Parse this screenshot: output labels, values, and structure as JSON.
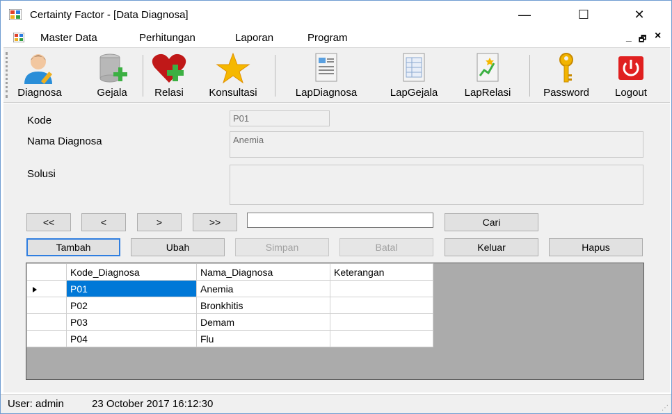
{
  "window": {
    "title": "Certainty Factor - [Data Diagnosa]",
    "controls": {
      "minimize": "—",
      "maximize": "☐",
      "close": "✕"
    }
  },
  "menu": {
    "items": [
      "Master Data",
      "Perhitungan",
      "Laporan",
      "Program"
    ],
    "mdi": {
      "minimize": "_",
      "restore": "🗗",
      "close": "×"
    }
  },
  "toolbar": {
    "items": [
      {
        "label": "Diagnosa",
        "icon": "user-edit-icon"
      },
      {
        "label": "Gejala",
        "icon": "database-add-icon"
      },
      {
        "label": "Relasi",
        "icon": "heart-add-icon"
      },
      {
        "label": "Konsultasi",
        "icon": "star-icon"
      },
      {
        "label": "LapDiagnosa",
        "icon": "report-icon"
      },
      {
        "label": "LapGejala",
        "icon": "table-report-icon"
      },
      {
        "label": "LapRelasi",
        "icon": "chart-report-icon"
      },
      {
        "label": "Password",
        "icon": "key-icon"
      },
      {
        "label": "Logout",
        "icon": "power-icon"
      }
    ]
  },
  "form": {
    "kode_label": "Kode",
    "kode_value": "P01",
    "nama_label": "Nama Diagnosa",
    "nama_value": "Anemia",
    "solusi_label": "Solusi",
    "solusi_value": ""
  },
  "nav": {
    "first": "<<",
    "prev": "<",
    "next": ">",
    "last": ">>",
    "search_value": "",
    "search_button": "Cari"
  },
  "actions": {
    "tambah": "Tambah",
    "ubah": "Ubah",
    "simpan": "Simpan",
    "batal": "Batal",
    "keluar": "Keluar",
    "hapus": "Hapus"
  },
  "grid": {
    "columns": [
      "Kode_Diagnosa",
      "Nama_Diagnosa",
      "Keterangan"
    ],
    "rows": [
      {
        "kode": "P01",
        "nama": "Anemia",
        "ket": ""
      },
      {
        "kode": "P02",
        "nama": "Bronkhitis",
        "ket": ""
      },
      {
        "kode": "P03",
        "nama": "Demam",
        "ket": ""
      },
      {
        "kode": "P04",
        "nama": "Flu",
        "ket": ""
      }
    ]
  },
  "status": {
    "user": "User: admin",
    "datetime": "23 October 2017 16:12:30"
  },
  "colors": {
    "selection": "#0078d7",
    "focus": "#2f7ee0",
    "form_bg": "#f0f0f0",
    "grid_bg": "#ababab"
  }
}
